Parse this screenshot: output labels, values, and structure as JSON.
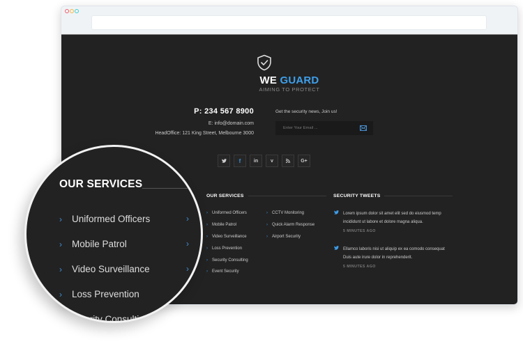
{
  "browser": {
    "window_controls": [
      {
        "name": "close",
        "color": "#f05b6f"
      },
      {
        "name": "minimize",
        "color": "#f5b841"
      },
      {
        "name": "maximize",
        "color": "#3ccfcf"
      }
    ],
    "address_bar": {
      "value": ""
    }
  },
  "brand": {
    "logo_icon": "shield-check-icon",
    "name_part1": "WE",
    "name_part2": "GUARD",
    "tagline": "AIMING TO PROTECT",
    "accent_color": "#3ea0ec"
  },
  "contact": {
    "phone": "P: 234 567 8900",
    "email": "E: info@domain.com",
    "office": "HeadOffice: 121 King Street, Melbourne 3000"
  },
  "newsletter": {
    "label": "Get the security news, Join us!",
    "placeholder": "Enter Your Email ...",
    "value": "",
    "submit_icon": "envelope-icon"
  },
  "socials": [
    {
      "name": "twitter",
      "glyph": "t"
    },
    {
      "name": "facebook",
      "glyph": "f"
    },
    {
      "name": "linkedin",
      "glyph": "in"
    },
    {
      "name": "vimeo",
      "glyph": "v"
    },
    {
      "name": "rss",
      "glyph": "rss"
    },
    {
      "name": "google-plus",
      "glyph": "G+"
    }
  ],
  "services": {
    "title": "OUR SERVICES",
    "column1": [
      "Uniformed Officers",
      "Mobile Patrol",
      "Video Surveillance",
      "Loss Prevention",
      "Security Consulting",
      "Event Security"
    ],
    "column2": [
      "CCTV Monitoring",
      "Quick Alarm Response",
      "Airport Security"
    ]
  },
  "tweets": {
    "title": "SECURITY TWEETS",
    "items": [
      {
        "text": "Lorem ipsum dolor sit amet elit sed do eiusmod temp incididunt ut labore et dolore magna aliqua.",
        "time": "5 MINUTES AGO"
      },
      {
        "text": "Ellamco laboris nisi ut aliquip ex ea comodo consequat Duis aute irure dolor in reprehenderit.",
        "time": "5 MINUTES AGO"
      }
    ]
  },
  "magnifier": {
    "title": "OUR SERVICES",
    "items": [
      "Uniformed Officers",
      "Mobile Patrol",
      "Video Surveillance",
      "Loss Prevention",
      "Security Consulting"
    ]
  }
}
